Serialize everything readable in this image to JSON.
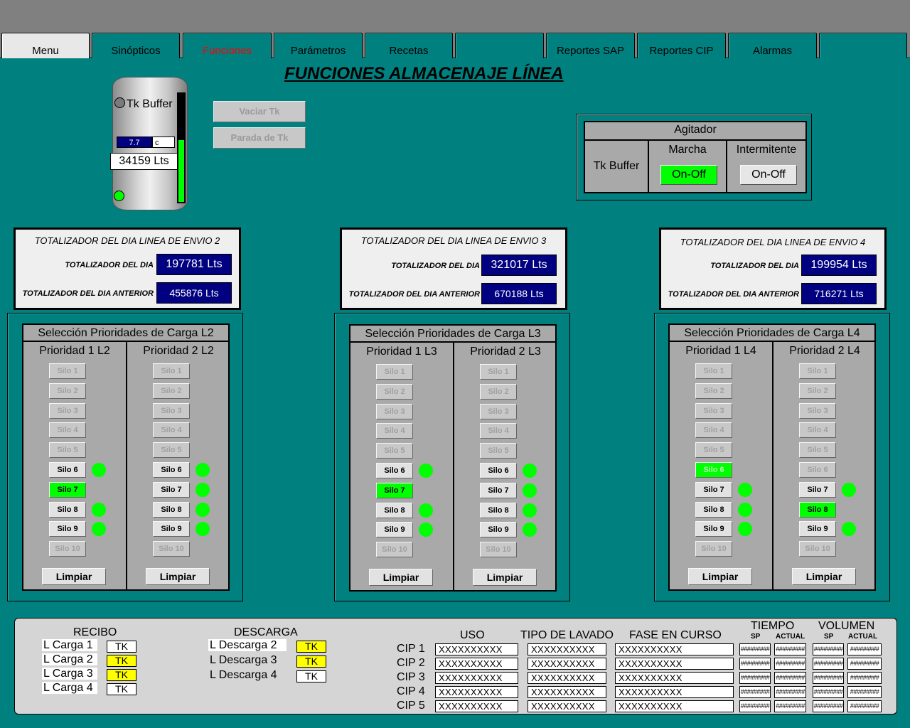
{
  "tabs": [
    {
      "label": "Menu",
      "active": true
    },
    {
      "label": "Sinópticos"
    },
    {
      "label": "Funciones",
      "highlight": true
    },
    {
      "label": "Parámetros"
    },
    {
      "label": "Recetas"
    },
    {
      "label": ""
    },
    {
      "label": "Reportes SAP"
    },
    {
      "label": "Reportes CIP"
    },
    {
      "label": "Alarmas"
    },
    {
      "label": ""
    }
  ],
  "page_title": "FUNCIONES ALMACENAJE LÍNEA",
  "tank": {
    "name": "Tk Buffer",
    "temperature": "7.7",
    "temperature_unit": "c",
    "volume": "34159 Lts",
    "level_fraction": 0.57
  },
  "tank_buttons": {
    "vaciar": "Vaciar Tk",
    "parada": "Parada de Tk"
  },
  "agitator": {
    "header": "Agitador",
    "row_label": "Tk Buffer",
    "marcha_label": "Marcha",
    "marcha_button": "On-Off",
    "intermitente_label": "Intermitente",
    "intermitente_button": "On-Off"
  },
  "totalizers": [
    {
      "title": "TOTALIZADOR DEL DIA LINEA DE ENVIO 2",
      "day_label": "TOTALIZADOR DEL DIA",
      "day_value": "197781 Lts",
      "prev_label": "TOTALIZADOR DEL DIA ANTERIOR",
      "prev_value": "455876 Lts"
    },
    {
      "title": "TOTALIZADOR DEL DIA LINEA DE ENVIO 3",
      "day_label": "TOTALIZADOR DEL DIA",
      "day_value": "321017 Lts",
      "prev_label": "TOTALIZADOR DEL DIA ANTERIOR",
      "prev_value": "670188 Lts"
    },
    {
      "title": "TOTALIZADOR DEL DIA LINEA DE ENVIO 4",
      "day_label": "TOTALIZADOR DEL DIA",
      "day_value": "199954 Lts",
      "prev_label": "TOTALIZADOR DEL DIA ANTERIOR",
      "prev_value": "716271 Lts"
    }
  ],
  "selections": [
    {
      "title": "Selección Prioridades de Carga L2",
      "columns": [
        {
          "label": "Prioridad 1 L2",
          "states": [
            "dis",
            "dis",
            "dis",
            "dis",
            "dis",
            "en",
            "sel1",
            "en",
            "en",
            "dis"
          ],
          "dots": [
            false,
            false,
            false,
            false,
            false,
            true,
            false,
            true,
            true,
            false
          ]
        },
        {
          "label": "Prioridad 2 L2",
          "states": [
            "dis",
            "dis",
            "dis",
            "dis",
            "dis",
            "en",
            "en",
            "en",
            "en",
            "dis"
          ],
          "dots": [
            false,
            false,
            false,
            false,
            false,
            true,
            true,
            true,
            true,
            false
          ]
        }
      ],
      "clear": "Limpiar"
    },
    {
      "title": "Selección Prioridades de Carga L3",
      "columns": [
        {
          "label": "Prioridad 1 L3",
          "states": [
            "dis",
            "dis",
            "dis",
            "dis",
            "dis",
            "en",
            "sel1",
            "en",
            "en",
            "dis"
          ],
          "dots": [
            false,
            false,
            false,
            false,
            false,
            true,
            false,
            true,
            true,
            false
          ]
        },
        {
          "label": "Prioridad 2 L3",
          "states": [
            "dis",
            "dis",
            "dis",
            "dis",
            "dis",
            "en",
            "en",
            "en",
            "en",
            "dis"
          ],
          "dots": [
            false,
            false,
            false,
            false,
            false,
            true,
            true,
            true,
            true,
            false
          ]
        }
      ],
      "clear": "Limpiar"
    },
    {
      "title": "Selección Prioridades de Carga L4",
      "columns": [
        {
          "label": "Prioridad 1 L4",
          "states": [
            "dis",
            "dis",
            "dis",
            "dis",
            "dis",
            "seldis",
            "en",
            "en",
            "en",
            "dis"
          ],
          "dots": [
            false,
            false,
            false,
            false,
            false,
            false,
            true,
            true,
            true,
            false
          ]
        },
        {
          "label": "Prioridad 2 L4",
          "states": [
            "dis",
            "dis",
            "dis",
            "dis",
            "dis",
            "dis",
            "en",
            "sel1",
            "en",
            "dis"
          ],
          "dots": [
            false,
            false,
            false,
            false,
            false,
            false,
            true,
            false,
            true,
            false
          ]
        }
      ],
      "clear": "Limpiar"
    }
  ],
  "silo_labels": [
    "Silo 1",
    "Silo 2",
    "Silo 3",
    "Silo 4",
    "Silo 5",
    "Silo 6",
    "Silo 7",
    "Silo 8",
    "Silo 9",
    "Silo 10"
  ],
  "recibo": {
    "title": "RECIBO",
    "rows": [
      {
        "label": "L Carga 1",
        "tk": "TK",
        "color": "w"
      },
      {
        "label": "L Carga 2",
        "tk": "TK",
        "color": "y"
      },
      {
        "label": "L Carga 3",
        "tk": "TK",
        "color": "y"
      },
      {
        "label": "L Carga 4",
        "tk": "TK",
        "color": "w"
      }
    ]
  },
  "descarga": {
    "title": "DESCARGA",
    "rows": [
      {
        "label": "L Descarga 2",
        "tk": "TK",
        "color": "y",
        "boxed": true
      },
      {
        "label": "L Descarga 3",
        "tk": "TK",
        "color": "y",
        "boxed": false
      },
      {
        "label": "L Descarga 4",
        "tk": "TK",
        "color": "w",
        "boxed": false
      }
    ]
  },
  "cip": {
    "headers": {
      "uso": "USO",
      "tipo": "TIPO DE LAVADO",
      "fase": "FASE EN CURSO",
      "tiempo": "TIEMPO",
      "volumen": "VOLUMEN",
      "sp": "SP",
      "actual": "ACTUAL"
    },
    "rows": [
      {
        "label": "CIP 1",
        "uso": "XXXXXXXXXX",
        "tipo": "XXXXXXXXXX",
        "fase": "XXXXXXXXXX",
        "t_sp": "#########",
        "t_act": "#########",
        "v_sp": "#########",
        "v_act": "#########"
      },
      {
        "label": "CIP 2",
        "uso": "XXXXXXXXXX",
        "tipo": "XXXXXXXXXX",
        "fase": "XXXXXXXXXX",
        "t_sp": "#########",
        "t_act": "#########",
        "v_sp": "#########",
        "v_act": "#########"
      },
      {
        "label": "CIP 3",
        "uso": "XXXXXXXXXX",
        "tipo": "XXXXXXXXXX",
        "fase": "XXXXXXXXXX",
        "t_sp": "#########",
        "t_act": "#########",
        "v_sp": "#########",
        "v_act": "#########"
      },
      {
        "label": "CIP 4",
        "uso": "XXXXXXXXXX",
        "tipo": "XXXXXXXXXX",
        "fase": "XXXXXXXXXX",
        "t_sp": "#########",
        "t_act": "#########",
        "v_sp": "#########",
        "v_act": "#########"
      },
      {
        "label": "CIP 5",
        "uso": "XXXXXXXXXX",
        "tipo": "XXXXXXXXXX",
        "fase": "XXXXXXXXXX",
        "t_sp": "#########",
        "t_act": "#########",
        "v_sp": "#########",
        "v_act": "#########"
      }
    ]
  },
  "colors": {
    "background": "#00807f",
    "panel": "#a9a9a9",
    "active_green": "#00ff00",
    "value_blue": "#000080",
    "tk_yellow": "#ffff00"
  }
}
